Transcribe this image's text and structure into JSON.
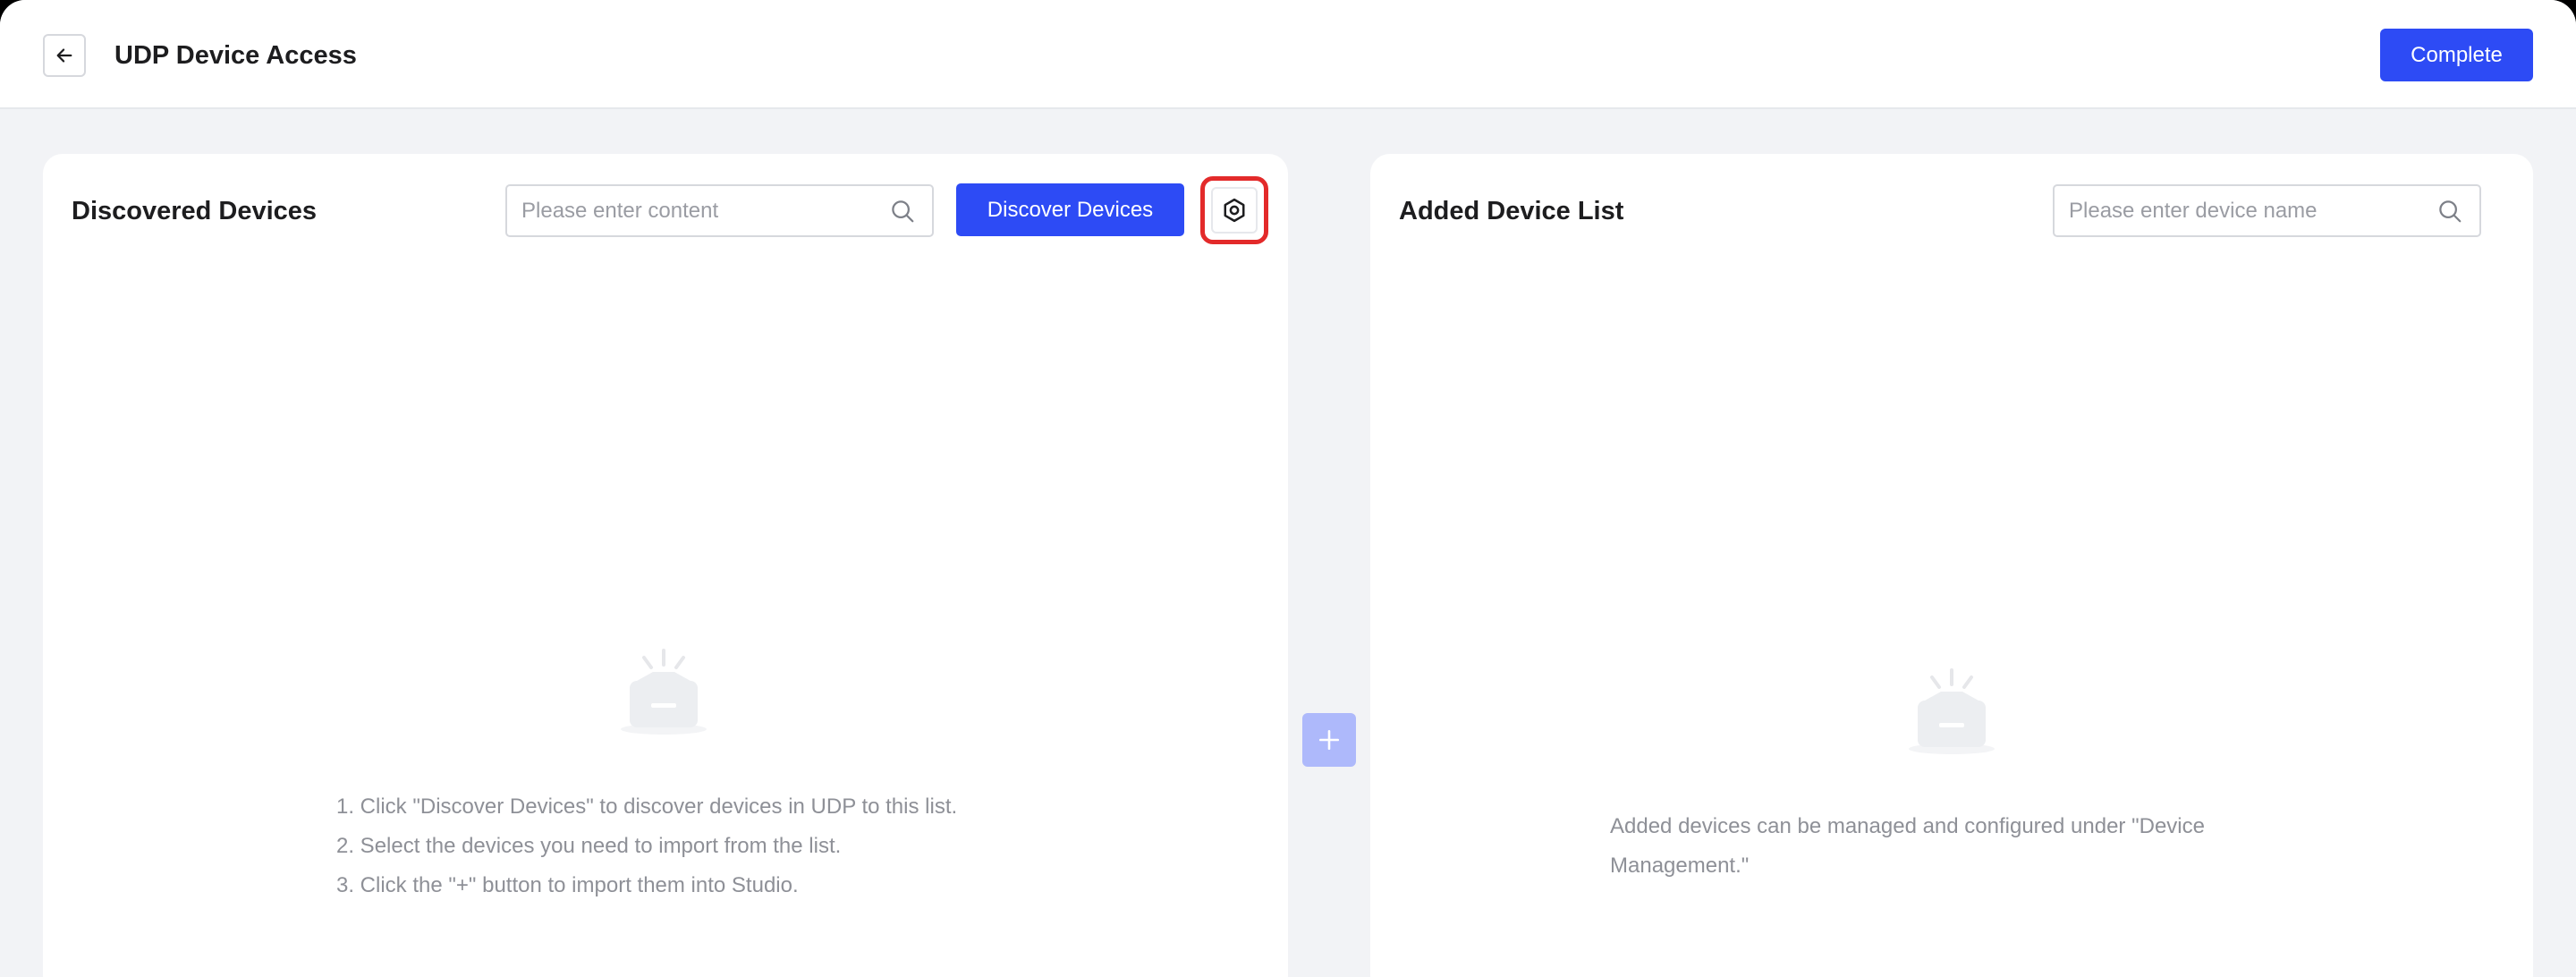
{
  "header": {
    "title": "UDP Device Access",
    "complete_label": "Complete"
  },
  "discovered": {
    "title": "Discovered Devices",
    "search_placeholder": "Please enter content",
    "discover_label": "Discover Devices",
    "hints": [
      "1. Click \"Discover Devices\" to discover devices in UDP to this list.",
      "2. Select the devices you need to import from the list.",
      "3. Click the \"+\" button to import them into Studio."
    ]
  },
  "added": {
    "title": "Added Device List",
    "search_placeholder": "Please enter device name",
    "hint": "Added devices can be managed and configured under \"Device Management.\""
  },
  "icons": {
    "back": "arrow-left-icon",
    "search": "search-icon",
    "settings": "hexagon-settings-icon",
    "add": "plus-icon",
    "empty": "empty-box-icon"
  },
  "colors": {
    "primary": "#2d4bf5",
    "add_button_disabled": "#aeb9fb",
    "highlight": "#e32a2a",
    "background": "#f2f3f6"
  }
}
